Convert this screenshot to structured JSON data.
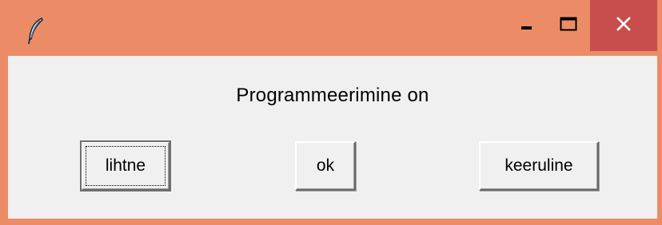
{
  "window": {
    "title": "",
    "titlebar_color": "#eb8c66",
    "close_hover_color": "#c84d4d",
    "icon": "feather-icon"
  },
  "controls": {
    "minimize_icon": "minimize-icon",
    "maximize_icon": "maximize-icon",
    "close_icon": "close-icon"
  },
  "content": {
    "label": "Programmeerimine on",
    "buttons": [
      {
        "label": "lihtne",
        "focused": true
      },
      {
        "label": "ok",
        "focused": false
      },
      {
        "label": "keeruline",
        "focused": false
      }
    ]
  }
}
